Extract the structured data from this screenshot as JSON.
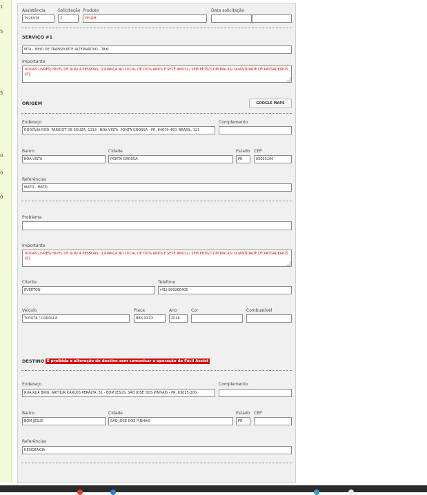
{
  "sidebar": {
    "marks": [
      "1",
      "5",
      "5",
      "0",
      "0",
      "0"
    ]
  },
  "header": {
    "assistencia_label": "Assistência",
    "assistencia_value": "7926976",
    "solicitacao_label": "Solicitação",
    "solicitacao_value": "2",
    "produto_label": "Produto",
    "produto_value": "YELUM",
    "data_label": "Data solicitação",
    "data_value": "",
    "hora_value": ""
  },
  "servico": {
    "title": "SERVIÇO #1",
    "value": "MTA - MEIO DE TRANSPORTE ALTERNATIVO - TAXI",
    "importante_label": "Importante",
    "importante_text": "RODAS LIVRES/ NIVEL DE RUA/ 4 PESSOAS/ (CRIANÇA NO LOCAL DE DOIS ANOS E SETE ANOS) / SEM PETS/ COM MALAS/ QUANTIDADE DE PASSAGEIROS [4]"
  },
  "origem": {
    "title": "ORIGEM",
    "maps_button": "GOOGLE MAPS",
    "endereco_label": "Endereço",
    "endereco_value": "RODOVIA ROD. PARIGOT DE SOUZA, 1213 - BOA VISTA, PONTA GROSSA - PR, 84070-450, BRASIL, 121",
    "complemento_label": "Complemento",
    "complemento_value": "",
    "bairro_label": "Bairro",
    "bairro_value": "BOA VISTA",
    "cidade_label": "Cidade",
    "cidade_value": "PONTA GROSSA",
    "estado_label": "Estado",
    "estado_value": "PR",
    "cep_label": "CEP",
    "cep_value": "83025200",
    "referencias_label": "Referências",
    "referencias_value": "MATO - MATO"
  },
  "problema": {
    "problema_label": "Problema",
    "problema_value": "",
    "importante_label": "Importante",
    "importante_text": "RODAS LIVRES/ NIVEL DE RUA/ 4 PESSOAS/ (CRIANÇA NO LOCAL DE DOIS ANOS E SETE ANOS) / SEM PETS/ COM MALAS/ QUANTIDADE DE PASSAGEIROS [4]",
    "cliente_label": "Cliente",
    "cliente_value": "EVERTON",
    "telefone_label": "Telefone",
    "telefone_value": "(41) 999260405",
    "veiculo_label": "Veículo",
    "veiculo_value": "TOYOTA / COROLLA",
    "placa_label": "Placa",
    "placa_value": "BBX-XXXX",
    "ano_label": "Ano",
    "ano_value": "2016",
    "cor_label": "Cor",
    "cor_value": "",
    "combustivel_label": "Combustível",
    "combustivel_value": ""
  },
  "destino": {
    "title": "DESTINO",
    "warning": "É proibida a alteração de destino sem comunicar a operação da Fácil Assist",
    "endereco_label": "Endereço",
    "endereco_value": "RUA RUA BRIG. ARTHUR CARLOS PERALTA, 51 - BOM JESUS, SÃO JOSÉ DOS PINHAIS - PR, 83025-200,",
    "complemento_label": "Complemento",
    "complemento_value": "",
    "bairro_label": "Bairro",
    "bairro_value": "BOM JESUS",
    "cidade_label": "Cidade",
    "cidade_value": "SÃO JOSÉ DOS PINHAIS",
    "estado_label": "Estado",
    "estado_value": "PR",
    "cep_label": "CEP",
    "cep_value": "",
    "referencias_label": "Referências",
    "referencias_value": "RESIDENCIA"
  },
  "colors": {
    "warning_bg": "#d10f0f",
    "important_text": "#cc1111",
    "panel_bg": "#f0f0f0"
  },
  "taskbar": {
    "icons": [
      "red-app-icon",
      "blue-app-icon",
      "green-app-icon",
      "white-app-icon"
    ]
  }
}
